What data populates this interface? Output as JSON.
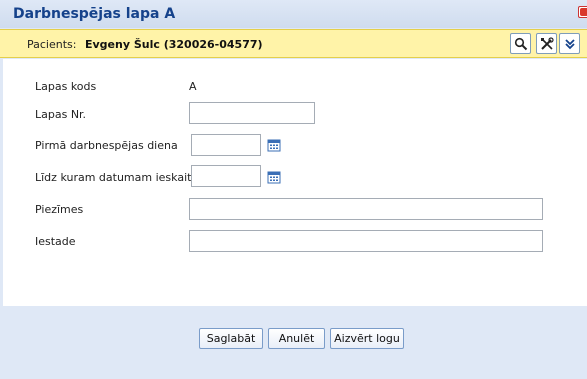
{
  "window": {
    "title": "Darbnespējas lapa A",
    "close_icon": "close-icon"
  },
  "patient_bar": {
    "label": "Pacients:",
    "name": "Evgeny Šulc (320026-04577)",
    "buttons": [
      {
        "icon": "search-icon"
      },
      {
        "icon": "tools-icon"
      },
      {
        "icon": "collapse-icon"
      }
    ]
  },
  "form": {
    "code_label": "Lapas kods",
    "code_value": "A",
    "number_label": "Lapas Nr.",
    "number_value": "",
    "first_day_label": "Pirmā darbnespējas diena",
    "first_day_value": "",
    "until_label": "Līdz kuram datumam ieskaitot",
    "until_value": "",
    "notes_label": "Piezīmes",
    "notes_value": "",
    "institution_label": "Iestade",
    "institution_value": ""
  },
  "footer": {
    "save_label": "Saglabāt",
    "cancel_label": "Anulēt",
    "close_label": "Aizvērt logu"
  }
}
